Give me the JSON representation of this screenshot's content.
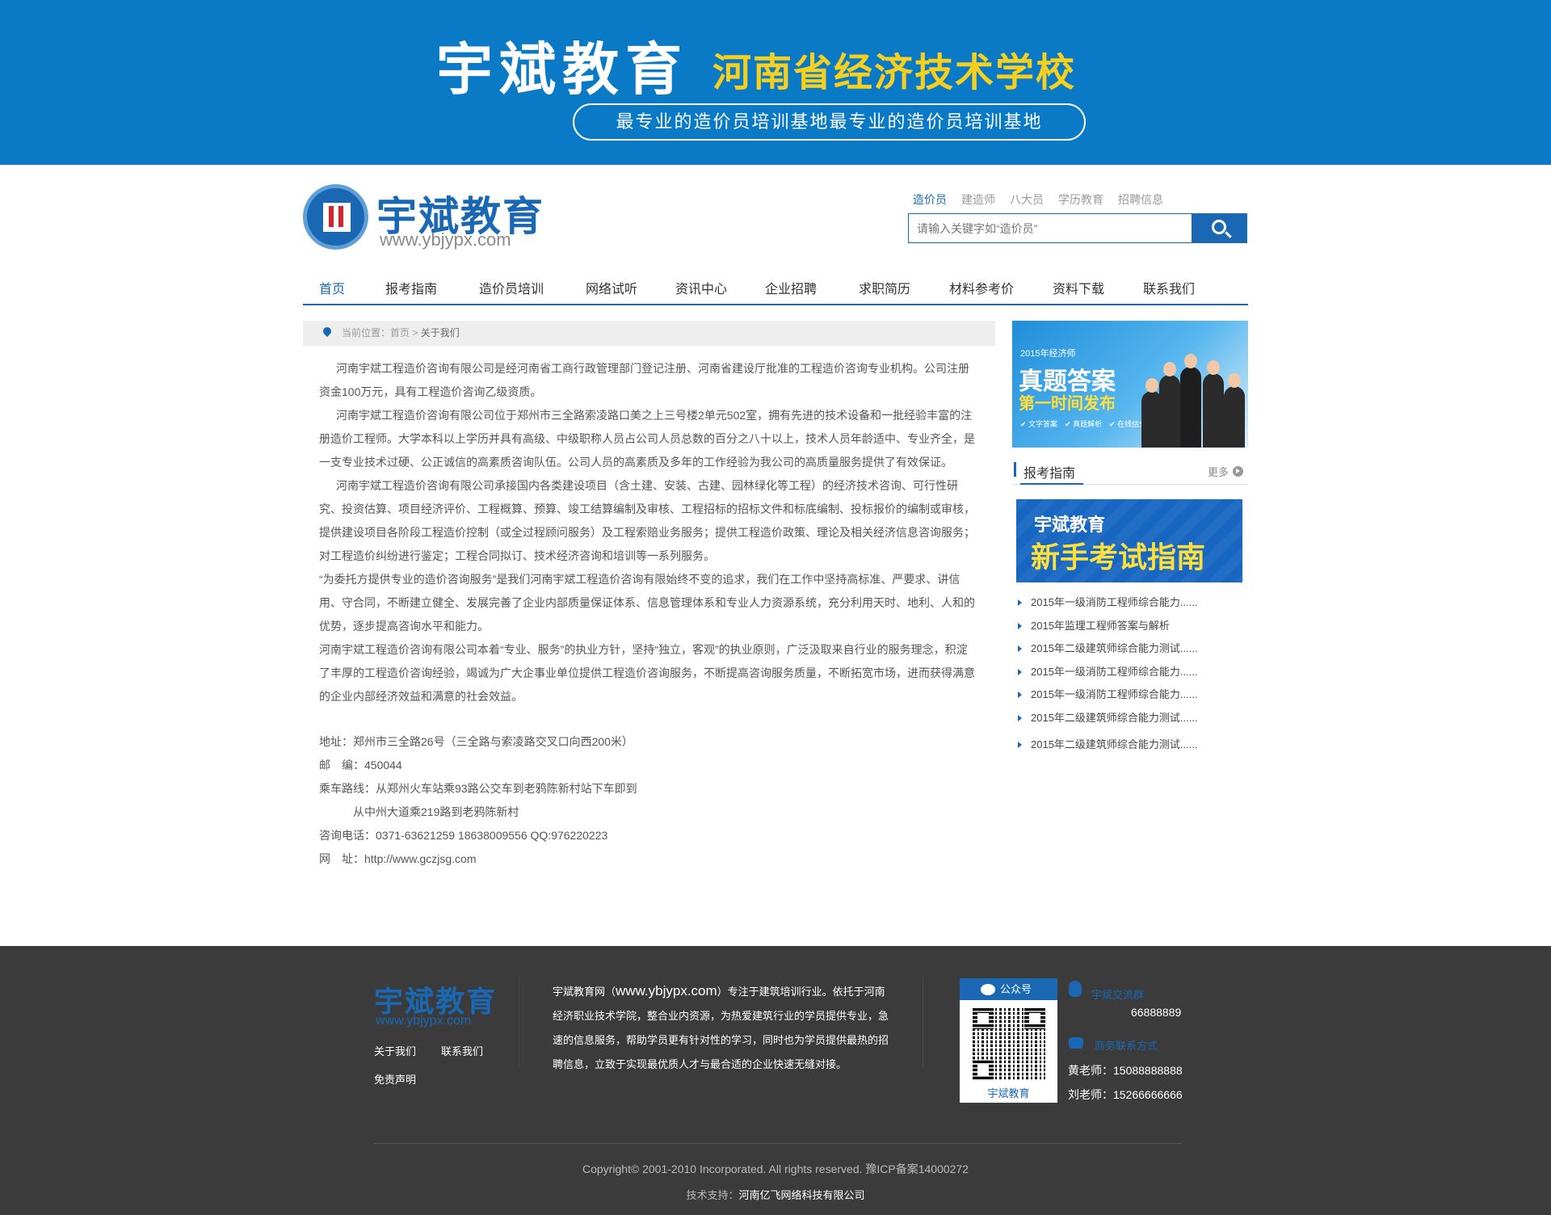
{
  "banner": {
    "title": "宇斌教育",
    "subtitle": "河南省经济技术学校",
    "pill": "最专业的造价员培训基地最专业的造价员培训基地",
    "bg_color": "#0a7ac7",
    "accent_color": "#f7cf1f"
  },
  "header": {
    "logo_text": "宇斌教育",
    "logo_url": "www.ybjypx.com",
    "search_tabs": [
      "造价员",
      "建造师",
      "八大员",
      "学历教育",
      "招聘信息"
    ],
    "search_placeholder": "请输入关键字如“造价员”"
  },
  "nav": {
    "items": [
      "首页",
      "报考指南",
      "造价员培训",
      "网络试听",
      "资讯中心",
      "企业招聘",
      "求职简历",
      "材料参考价",
      "资料下载",
      "联系我们"
    ],
    "active_index": 0
  },
  "breadcrumb": {
    "prefix": "当前位置：",
    "home": "首页",
    "sep": " > ",
    "current": "关于我们"
  },
  "article": {
    "paragraphs": [
      "河南宇斌工程造价咨询有限公司是经河南省工商行政管理部门登记注册、河南省建设厅批准的工程造价咨询专业机构。公司注册资金100万元，具有工程造价咨询乙级资质。",
      "河南宇斌工程造价咨询有限公司位于郑州市三全路索凌路口美之上三号楼2单元502室，拥有先进的技术设备和一批经验丰富的注册造价工程师。大学本科以上学历并具有高级、中级职称人员占公司人员总数的百分之八十以上，技术人员年龄适中、专业齐全，是一支专业技术过硬、公正诚信的高素质咨询队伍。公司人员的高素质及多年的工作经验为我公司的高质量服务提供了有效保证。",
      "河南宇斌工程造价咨询有限公司承接国内各类建设项目（含土建、安装、古建、园林绿化等工程）的经济技术咨询、可行性研究、投资估算、项目经济评价、工程概算、预算、竣工结算编制及审核、工程招标的招标文件和标底编制、投标报价的编制或审核，提供建设项目各阶段工程造价控制（或全过程顾问服务）及工程索赔业务服务；提供工程造价政策、理论及相关经济信息咨询服务；对工程造价纠纷进行鉴定；工程合同拟订、技术经济咨询和培训等一系列服务。",
      "“为委托方提供专业的造价咨询服务”是我们河南宇斌工程造价咨询有限始终不变的追求，我们在工作中坚持高标准、严要求、讲信用、守合同，不断建立健全、发展完善了企业内部质量保证体系、信息管理体系和专业人力资源系统，充分利用天时、地利、人和的优势，逐步提高咨询水平和能力。",
      "河南宇斌工程造价咨询有限公司本着“专业、服务”的执业方针，坚持“独立，客观”的执业原则，广泛汲取来自行业的服务理念，积淀了丰厚的工程造价咨询经验，竭诚为广大企事业单位提供工程造价咨询服务，不断提高咨询服务质量，不断拓宽市场，进而获得满意的企业内部经济效益和满意的社会效益。"
    ]
  },
  "contact": {
    "address": "地址：郑州市三全路26号（三全路与索凌路交叉口向西200米）",
    "postcode": "邮　编：450044",
    "route1": "乘车路线：从郑州火车站乘93路公交车到老鸦陈新村站下车即到",
    "route2": "从中州大道乘219路到老鸦陈新村",
    "phone": "咨询电话：0371-63621259 18638009556 QQ:976220223",
    "website": "网　址：http://www.gczjsg.com"
  },
  "sidebar": {
    "ad": {
      "small": "2015年经济师",
      "big": "真题答案",
      "yellow": "第一时间发布",
      "tags": "✔ 文字答案　✔ 真题解析　✔ 在线估分"
    },
    "section_title": "报考指南",
    "more_label": "更多",
    "guide_banner": {
      "line1": "宇斌教育",
      "line2": "新手考试指南"
    },
    "news": [
      "2015年一级消防工程师综合能力......",
      "2015年监理工程师答案与解析",
      "2015年二级建筑师综合能力测试......",
      "2015年一级消防工程师综合能力......",
      "2015年一级消防工程师综合能力......",
      "2015年二级建筑师综合能力测试......",
      "2015年二级建筑师综合能力测试......"
    ]
  },
  "footer": {
    "logo_text": "宇斌教育",
    "logo_url": "www.ybjypx.com",
    "links": [
      "关于我们",
      "联系我们",
      "免责声明"
    ],
    "about_pre": "宇斌教育网（",
    "about_url": "www.ybjypx.com",
    "about_post": "）专注于建筑培训行业。依托于河南经济职业技术学院，整合业内资源，为热爱建筑行业的学员提供专业，急速的信息服务，帮助学员更有针对性的学习，同时也为学员提供最热的招聘信息，立致于实现最优质人才与最合适的企业快速无缝对接。",
    "qr_head": "公众号",
    "qr_label": "宇斌教育",
    "qq_group_title": "宇斌交流群",
    "qq_group_number": "66888889",
    "business_title": "商务联系方式",
    "contact1": "黄老师：15088888888",
    "contact2": "刘老师：15266666666",
    "copyright": "Copyright© 2001-2010 Incorporated. All rights reserved. 豫ICP备案14000272",
    "tech_label": "技术支持：",
    "tech_company": "河南亿飞网络科技有限公司"
  }
}
